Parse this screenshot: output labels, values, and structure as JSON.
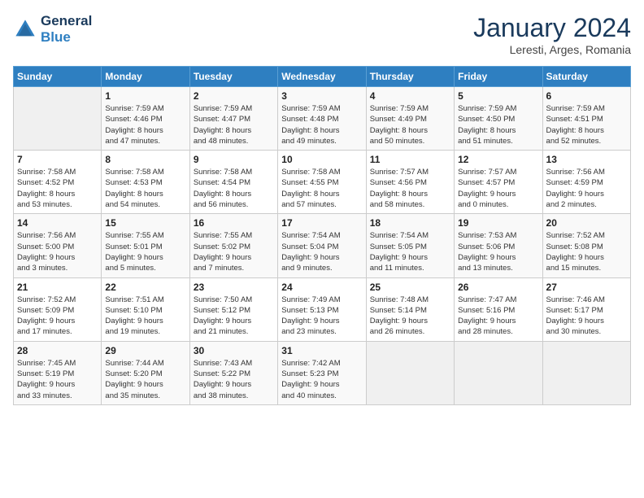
{
  "header": {
    "logo_line1": "General",
    "logo_line2": "Blue",
    "month": "January 2024",
    "location": "Leresti, Arges, Romania"
  },
  "weekdays": [
    "Sunday",
    "Monday",
    "Tuesday",
    "Wednesday",
    "Thursday",
    "Friday",
    "Saturday"
  ],
  "weeks": [
    [
      {
        "day": "",
        "info": ""
      },
      {
        "day": "1",
        "info": "Sunrise: 7:59 AM\nSunset: 4:46 PM\nDaylight: 8 hours\nand 47 minutes."
      },
      {
        "day": "2",
        "info": "Sunrise: 7:59 AM\nSunset: 4:47 PM\nDaylight: 8 hours\nand 48 minutes."
      },
      {
        "day": "3",
        "info": "Sunrise: 7:59 AM\nSunset: 4:48 PM\nDaylight: 8 hours\nand 49 minutes."
      },
      {
        "day": "4",
        "info": "Sunrise: 7:59 AM\nSunset: 4:49 PM\nDaylight: 8 hours\nand 50 minutes."
      },
      {
        "day": "5",
        "info": "Sunrise: 7:59 AM\nSunset: 4:50 PM\nDaylight: 8 hours\nand 51 minutes."
      },
      {
        "day": "6",
        "info": "Sunrise: 7:59 AM\nSunset: 4:51 PM\nDaylight: 8 hours\nand 52 minutes."
      }
    ],
    [
      {
        "day": "7",
        "info": "Sunrise: 7:58 AM\nSunset: 4:52 PM\nDaylight: 8 hours\nand 53 minutes."
      },
      {
        "day": "8",
        "info": "Sunrise: 7:58 AM\nSunset: 4:53 PM\nDaylight: 8 hours\nand 54 minutes."
      },
      {
        "day": "9",
        "info": "Sunrise: 7:58 AM\nSunset: 4:54 PM\nDaylight: 8 hours\nand 56 minutes."
      },
      {
        "day": "10",
        "info": "Sunrise: 7:58 AM\nSunset: 4:55 PM\nDaylight: 8 hours\nand 57 minutes."
      },
      {
        "day": "11",
        "info": "Sunrise: 7:57 AM\nSunset: 4:56 PM\nDaylight: 8 hours\nand 58 minutes."
      },
      {
        "day": "12",
        "info": "Sunrise: 7:57 AM\nSunset: 4:57 PM\nDaylight: 9 hours\nand 0 minutes."
      },
      {
        "day": "13",
        "info": "Sunrise: 7:56 AM\nSunset: 4:59 PM\nDaylight: 9 hours\nand 2 minutes."
      }
    ],
    [
      {
        "day": "14",
        "info": "Sunrise: 7:56 AM\nSunset: 5:00 PM\nDaylight: 9 hours\nand 3 minutes."
      },
      {
        "day": "15",
        "info": "Sunrise: 7:55 AM\nSunset: 5:01 PM\nDaylight: 9 hours\nand 5 minutes."
      },
      {
        "day": "16",
        "info": "Sunrise: 7:55 AM\nSunset: 5:02 PM\nDaylight: 9 hours\nand 7 minutes."
      },
      {
        "day": "17",
        "info": "Sunrise: 7:54 AM\nSunset: 5:04 PM\nDaylight: 9 hours\nand 9 minutes."
      },
      {
        "day": "18",
        "info": "Sunrise: 7:54 AM\nSunset: 5:05 PM\nDaylight: 9 hours\nand 11 minutes."
      },
      {
        "day": "19",
        "info": "Sunrise: 7:53 AM\nSunset: 5:06 PM\nDaylight: 9 hours\nand 13 minutes."
      },
      {
        "day": "20",
        "info": "Sunrise: 7:52 AM\nSunset: 5:08 PM\nDaylight: 9 hours\nand 15 minutes."
      }
    ],
    [
      {
        "day": "21",
        "info": "Sunrise: 7:52 AM\nSunset: 5:09 PM\nDaylight: 9 hours\nand 17 minutes."
      },
      {
        "day": "22",
        "info": "Sunrise: 7:51 AM\nSunset: 5:10 PM\nDaylight: 9 hours\nand 19 minutes."
      },
      {
        "day": "23",
        "info": "Sunrise: 7:50 AM\nSunset: 5:12 PM\nDaylight: 9 hours\nand 21 minutes."
      },
      {
        "day": "24",
        "info": "Sunrise: 7:49 AM\nSunset: 5:13 PM\nDaylight: 9 hours\nand 23 minutes."
      },
      {
        "day": "25",
        "info": "Sunrise: 7:48 AM\nSunset: 5:14 PM\nDaylight: 9 hours\nand 26 minutes."
      },
      {
        "day": "26",
        "info": "Sunrise: 7:47 AM\nSunset: 5:16 PM\nDaylight: 9 hours\nand 28 minutes."
      },
      {
        "day": "27",
        "info": "Sunrise: 7:46 AM\nSunset: 5:17 PM\nDaylight: 9 hours\nand 30 minutes."
      }
    ],
    [
      {
        "day": "28",
        "info": "Sunrise: 7:45 AM\nSunset: 5:19 PM\nDaylight: 9 hours\nand 33 minutes."
      },
      {
        "day": "29",
        "info": "Sunrise: 7:44 AM\nSunset: 5:20 PM\nDaylight: 9 hours\nand 35 minutes."
      },
      {
        "day": "30",
        "info": "Sunrise: 7:43 AM\nSunset: 5:22 PM\nDaylight: 9 hours\nand 38 minutes."
      },
      {
        "day": "31",
        "info": "Sunrise: 7:42 AM\nSunset: 5:23 PM\nDaylight: 9 hours\nand 40 minutes."
      },
      {
        "day": "",
        "info": ""
      },
      {
        "day": "",
        "info": ""
      },
      {
        "day": "",
        "info": ""
      }
    ]
  ]
}
